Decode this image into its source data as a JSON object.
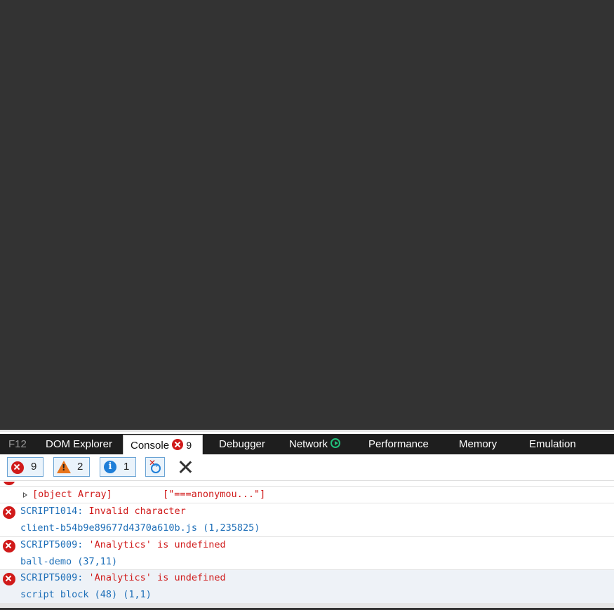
{
  "devtools": {
    "tabs": [
      {
        "label": "F12"
      },
      {
        "label": "DOM Explorer"
      },
      {
        "label": "Console",
        "error_count": "9"
      },
      {
        "label": "Debugger"
      },
      {
        "label": "Network"
      },
      {
        "label": "Performance"
      },
      {
        "label": "Memory"
      },
      {
        "label": "Emulation"
      }
    ],
    "filters": {
      "errors": "9",
      "warnings": "2",
      "info": "1"
    }
  },
  "console": {
    "entries": [
      {
        "message": "[object Array]",
        "value": "[\"===anonymou...\"]"
      },
      {
        "code": "SCRIPT1014:",
        "message": " Invalid character",
        "location": "client-b54b9e89677d4370a610b.js (1,235825)"
      },
      {
        "code": "SCRIPT5009:",
        "message": " 'Analytics' is undefined",
        "location": "ball-demo (37,11)"
      },
      {
        "code": "SCRIPT5009:",
        "message": " 'Analytics' is undefined",
        "location": "script block (48) (1,1)"
      }
    ]
  },
  "colors": {
    "page_background": "#333333",
    "tabbar": "#1e1e1e",
    "error": "#d01a1a",
    "link": "#1e6fb8",
    "selected_row": "#eef2f7"
  }
}
